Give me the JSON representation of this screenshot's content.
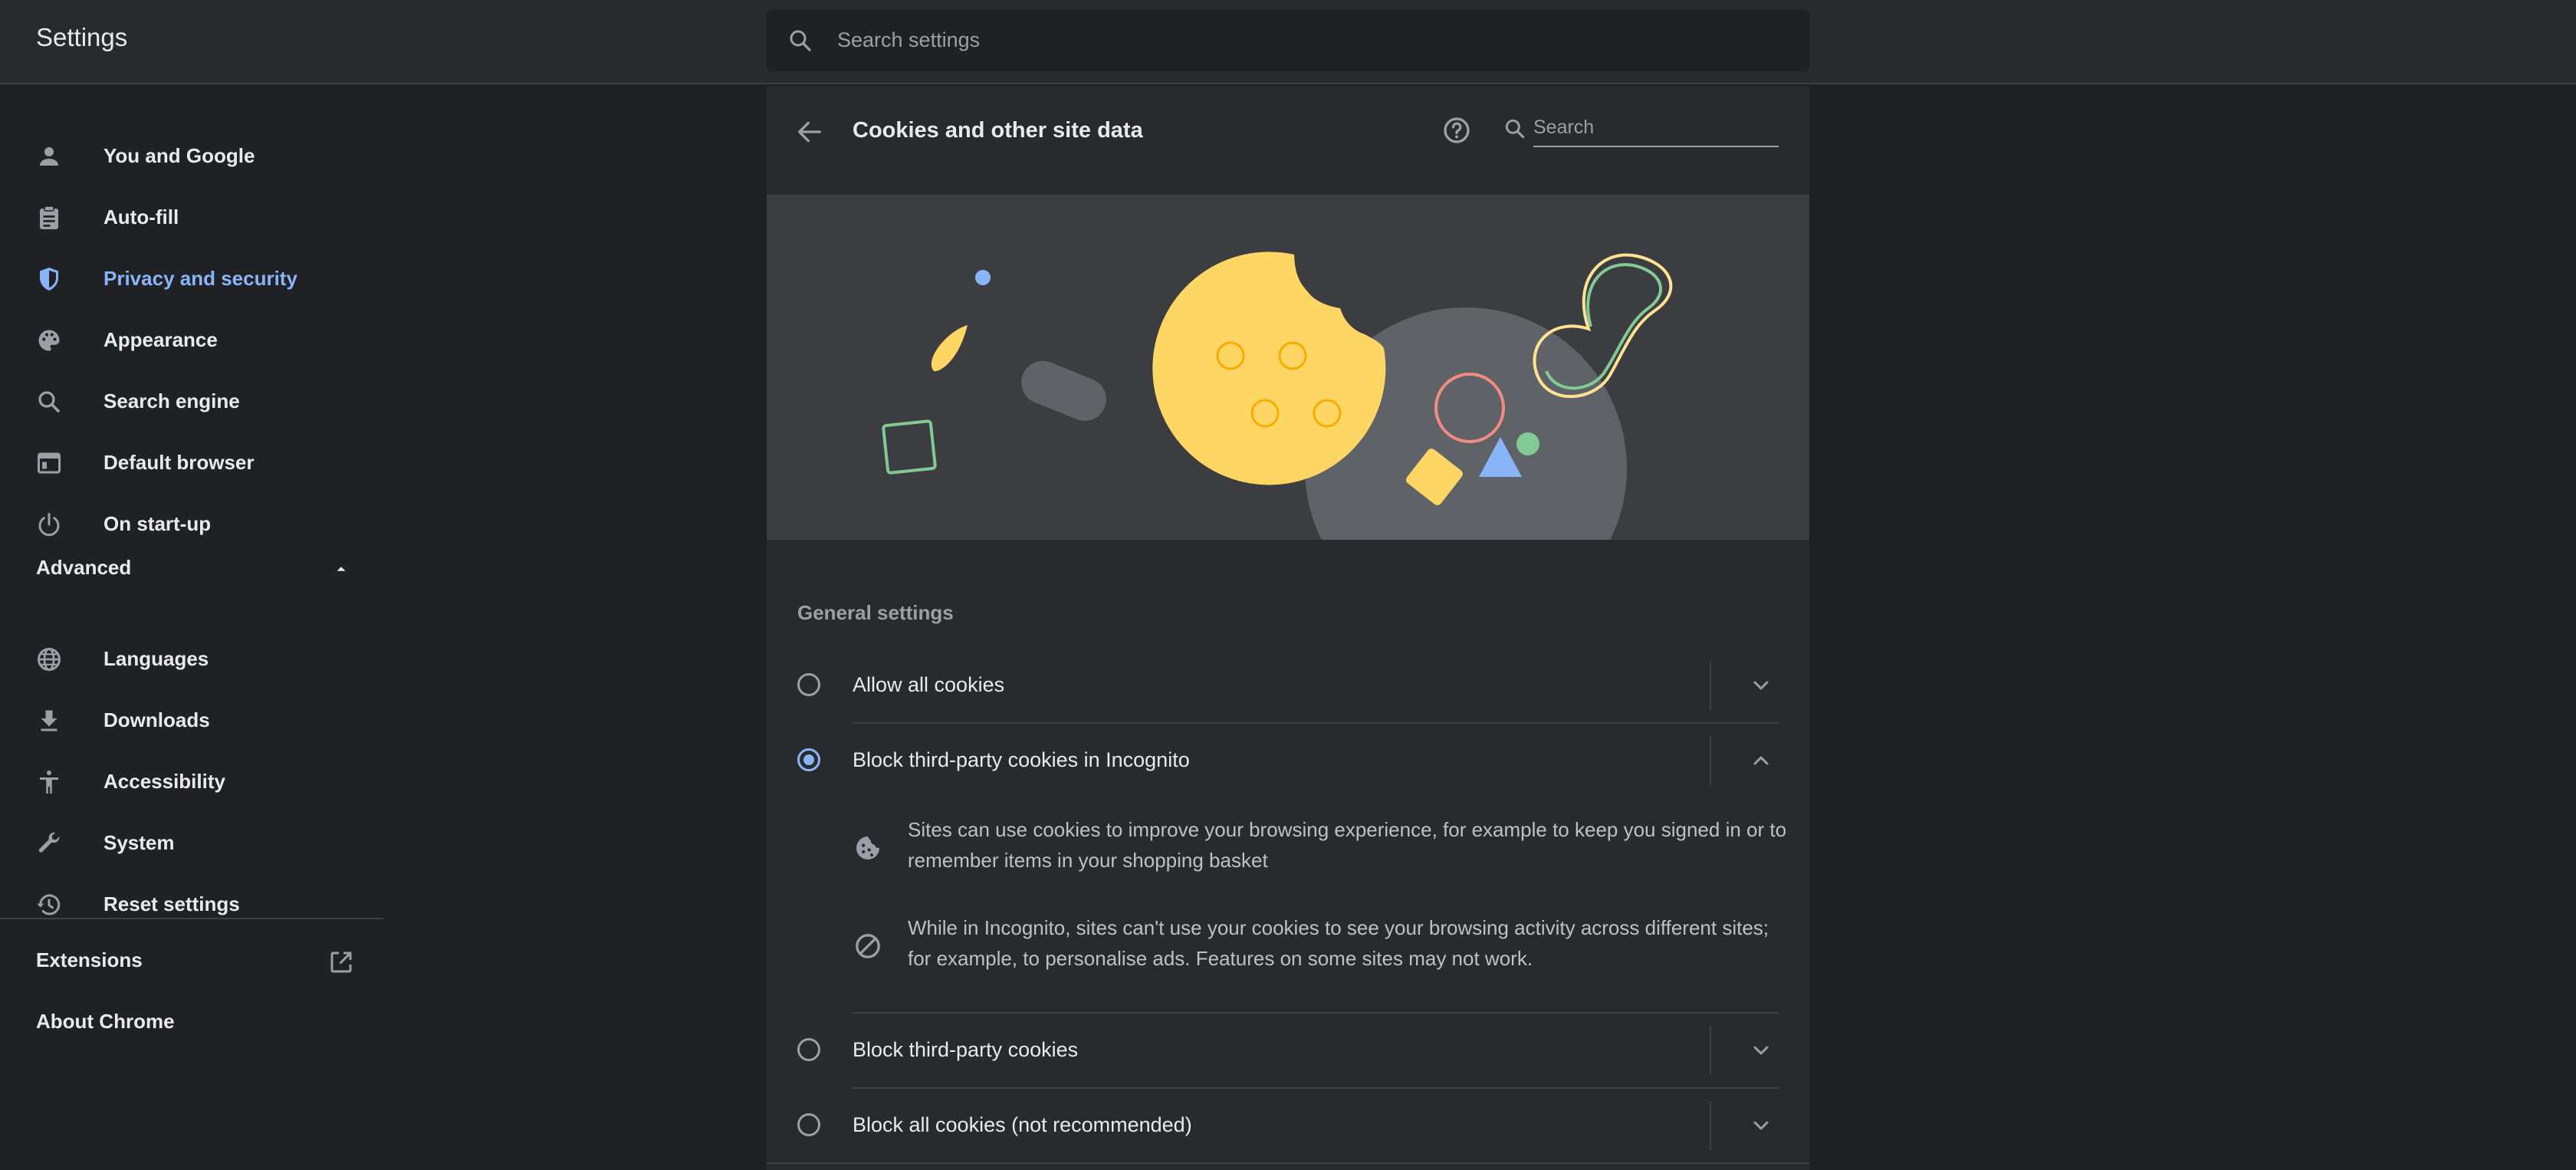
{
  "app": {
    "title": "Settings"
  },
  "search": {
    "placeholder": "Search settings"
  },
  "sidebar": {
    "items": [
      {
        "label": "You and Google",
        "icon": "person-icon"
      },
      {
        "label": "Auto-fill",
        "icon": "clipboard-icon"
      },
      {
        "label": "Privacy and security",
        "icon": "shield-icon",
        "active": true
      },
      {
        "label": "Appearance",
        "icon": "palette-icon"
      },
      {
        "label": "Search engine",
        "icon": "search-icon"
      },
      {
        "label": "Default browser",
        "icon": "browser-icon"
      },
      {
        "label": "On start-up",
        "icon": "power-icon"
      }
    ],
    "advanced_label": "Advanced",
    "advanced_items": [
      {
        "label": "Languages",
        "icon": "globe-icon"
      },
      {
        "label": "Downloads",
        "icon": "download-icon"
      },
      {
        "label": "Accessibility",
        "icon": "accessibility-icon"
      },
      {
        "label": "System",
        "icon": "wrench-icon"
      },
      {
        "label": "Reset settings",
        "icon": "history-icon"
      }
    ],
    "extensions_label": "Extensions",
    "about_label": "About Chrome"
  },
  "page": {
    "title": "Cookies and other site data",
    "search_placeholder": "Search",
    "section_title": "General settings",
    "options": [
      {
        "label": "Allow all cookies",
        "selected": false,
        "expanded": false
      },
      {
        "label": "Block third-party cookies in Incognito",
        "selected": true,
        "expanded": true
      },
      {
        "label": "Block third-party cookies",
        "selected": false,
        "expanded": false
      },
      {
        "label": "Block all cookies (not recommended)",
        "selected": false,
        "expanded": false
      }
    ],
    "details": [
      {
        "icon": "cookie-icon",
        "text": "Sites can use cookies to improve your browsing experience, for example to keep you signed in or to remember items in your shopping basket"
      },
      {
        "icon": "block-icon",
        "text": "While in Incognito, sites can't use your cookies to see your browsing activity across different sites; for example, to personalise ads. Features on some sites may not work."
      }
    ]
  },
  "colors": {
    "background": "#202124",
    "surface": "#292a2d",
    "accent": "#8ab4f8",
    "text": "#e8eaed",
    "secondary_text": "#9aa0a6",
    "cookie_yellow": "#fdd663"
  }
}
